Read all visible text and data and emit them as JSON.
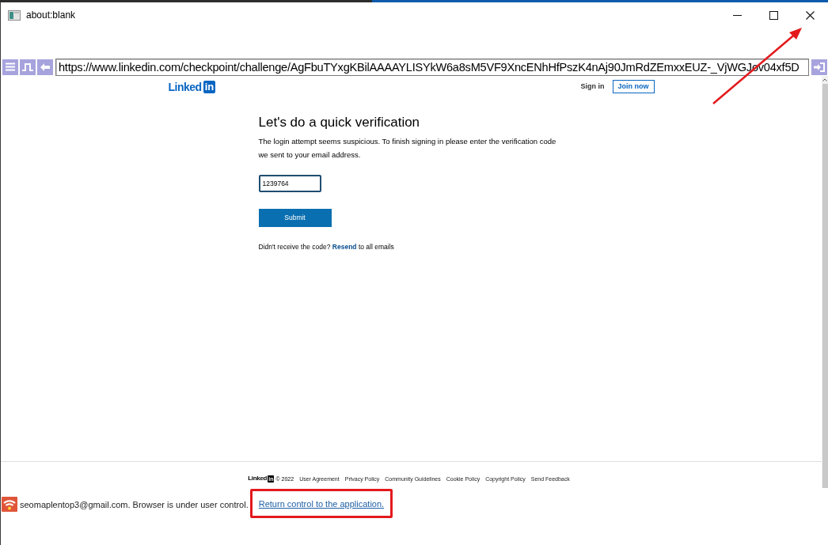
{
  "window": {
    "title": "about:blank"
  },
  "address_bar": {
    "value": "https://www.linkedin.com/checkpoint/challenge/AgFbuTYxgKBilAAAAYLISYkW6a8sM5VF9XncENhHfPszK4nAj90JmRdZEmxxEUZ-_VjWGJov04xf5D"
  },
  "page": {
    "header": {
      "logo": {
        "text": "Linked",
        "badge": "in"
      },
      "sign_in": "Sign in",
      "join_now": "Join now"
    },
    "heading": "Let's do a quick verification",
    "description": "The login attempt seems suspicious. To finish signing in please enter the verification code we sent to your email address.",
    "code_field": {
      "value": "1239764"
    },
    "submit_button": "Submit",
    "resend_note": {
      "text": "Didn't receive the code?",
      "link": "Resend",
      "suffix": "to all emails"
    },
    "footer": {
      "logo": {
        "text": "Linked",
        "badge": "in"
      },
      "copyright": "© 2022",
      "links": [
        "User Agreement",
        "Privacy Policy",
        "Community Guidelines",
        "Cookie Policy",
        "Copyright Policy",
        "Send Feedback"
      ]
    }
  },
  "status_bar": {
    "message": "seomaplentop3@gmail.com. Browser is under user control.",
    "link": "Return control to the application."
  }
}
